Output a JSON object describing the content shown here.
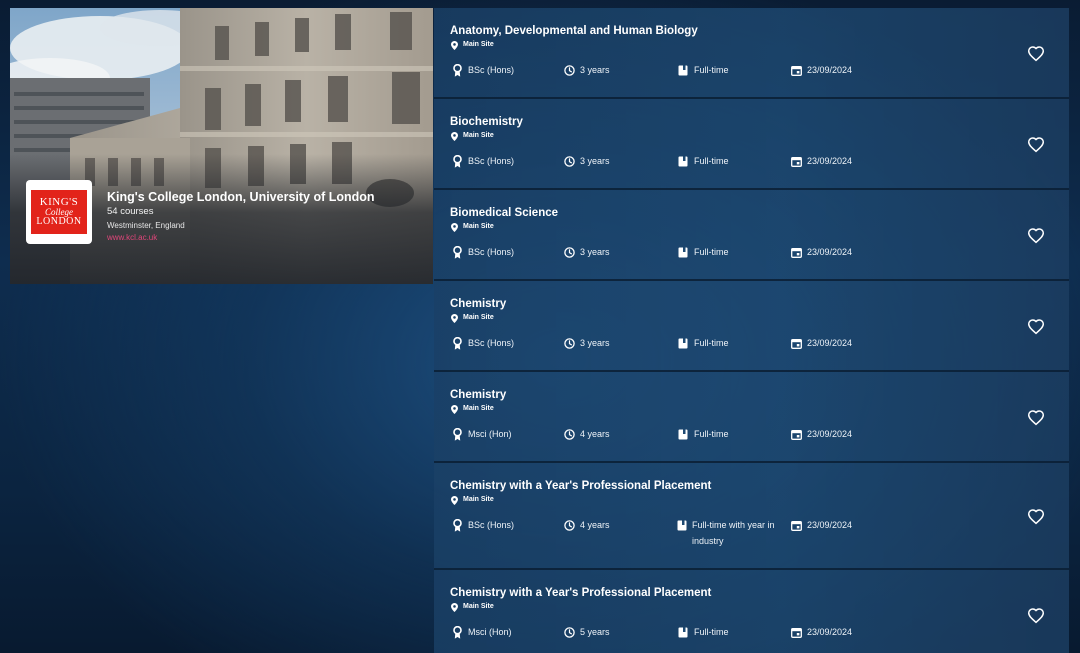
{
  "university": {
    "name": "King's College London, University of London",
    "courses_count": "54 courses",
    "location": "Westminster, England",
    "url": "www.kcl.ac.uk",
    "logo_lines": [
      "KING'S",
      "College",
      "LONDON"
    ]
  },
  "courses": [
    {
      "title": "Anatomy, Developmental and Human Biology",
      "site": "Main Site",
      "award": "BSc (Hons)",
      "duration": "3 years",
      "mode": "Full-time",
      "start": "23/09/2024"
    },
    {
      "title": "Biochemistry",
      "site": "Main Site",
      "award": "BSc (Hons)",
      "duration": "3 years",
      "mode": "Full-time",
      "start": "23/09/2024"
    },
    {
      "title": "Biomedical Science",
      "site": "Main Site",
      "award": "BSc (Hons)",
      "duration": "3 years",
      "mode": "Full-time",
      "start": "23/09/2024"
    },
    {
      "title": "Chemistry",
      "site": "Main Site",
      "award": "BSc (Hons)",
      "duration": "3 years",
      "mode": "Full-time",
      "start": "23/09/2024"
    },
    {
      "title": "Chemistry",
      "site": "Main Site",
      "award": "Msci (Hon)",
      "duration": "4 years",
      "mode": "Full-time",
      "start": "23/09/2024"
    },
    {
      "title": "Chemistry with a Year's Professional Placement",
      "site": "Main Site",
      "award": "BSc (Hons)",
      "duration": "4 years",
      "mode": "Full-time with year in industry",
      "start": "23/09/2024"
    },
    {
      "title": "Chemistry with a Year's Professional Placement",
      "site": "Main Site",
      "award": "Msci (Hon)",
      "duration": "5 years",
      "mode": "Full-time",
      "start": "23/09/2024"
    }
  ],
  "icons": {
    "site": "map-pin-icon",
    "award": "award-ribbon-icon",
    "duration": "clock-icon",
    "mode": "book-icon",
    "start": "calendar-icon",
    "favourite": "heart-icon"
  },
  "colors": {
    "url_link": "#e0467a",
    "logo_red": "#e2231a"
  }
}
